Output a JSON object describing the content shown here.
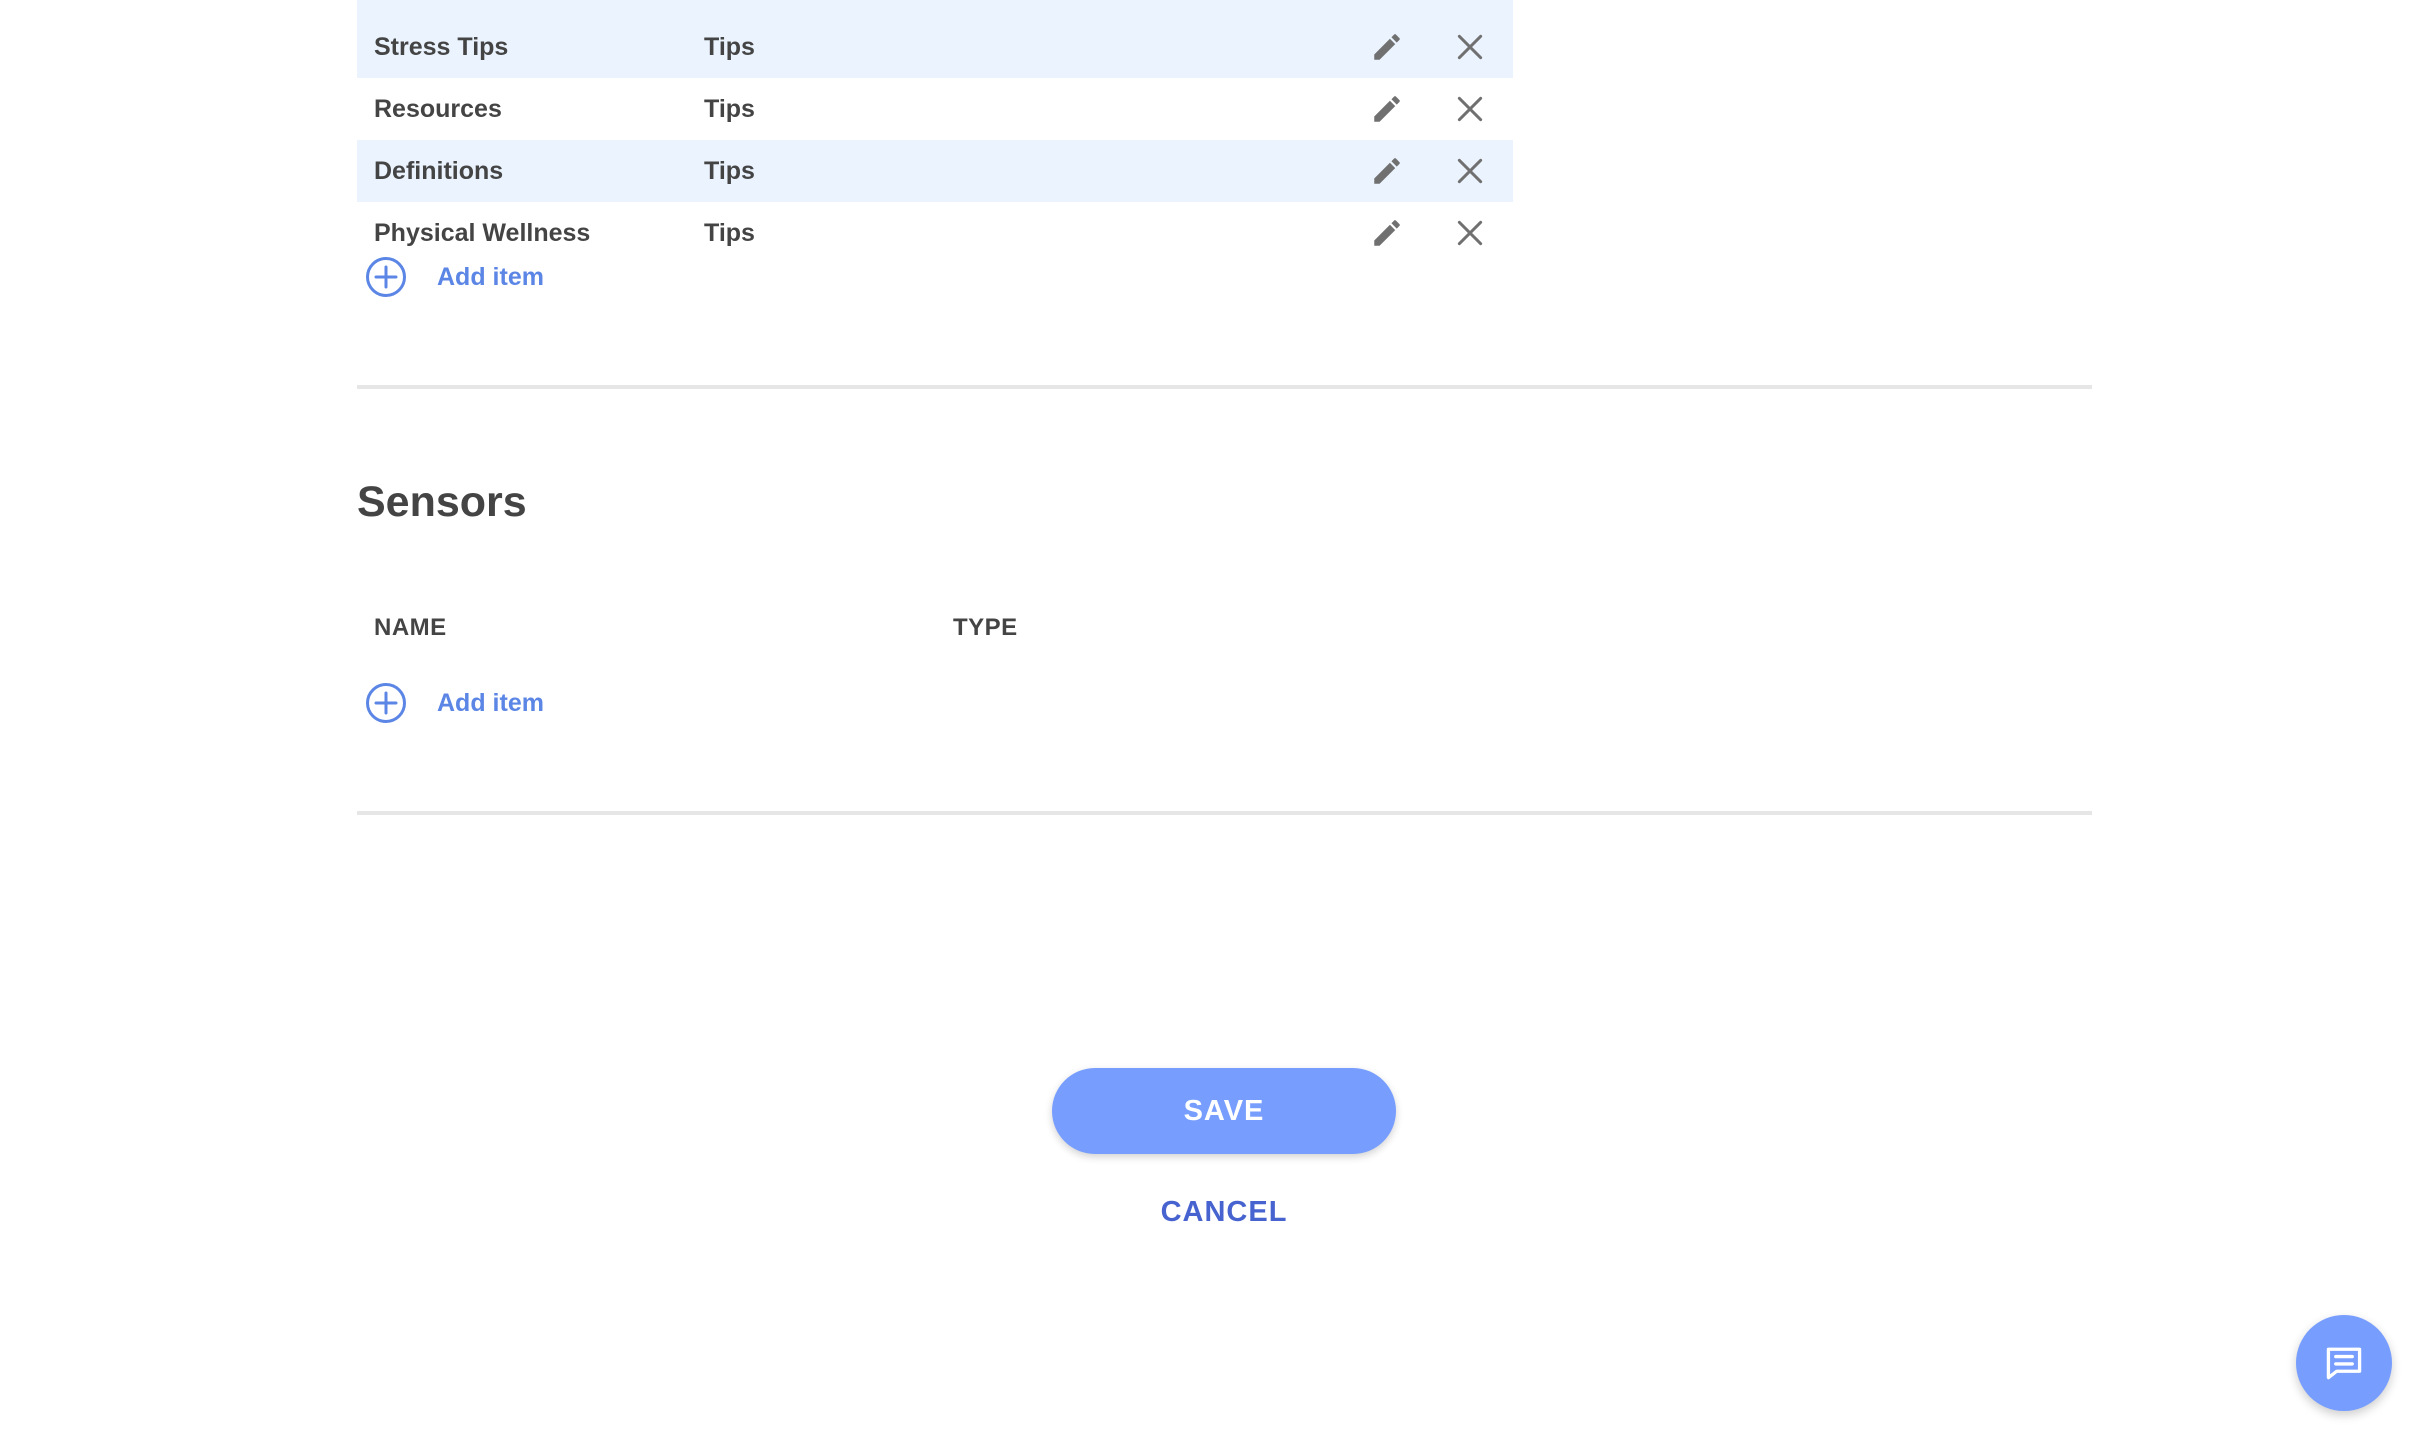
{
  "tips_table": {
    "rows": [
      {
        "name": "Stress Tips",
        "type": "Tips"
      },
      {
        "name": "Resources",
        "type": "Tips"
      },
      {
        "name": "Definitions",
        "type": "Tips"
      },
      {
        "name": "Physical Wellness",
        "type": "Tips"
      }
    ],
    "add_item_label": "Add item"
  },
  "sensors": {
    "title": "Sensors",
    "columns": {
      "name": "NAME",
      "type": "TYPE"
    },
    "add_item_label": "Add item"
  },
  "actions": {
    "save_label": "SAVE",
    "cancel_label": "CANCEL"
  },
  "icons": {
    "edit": "pencil-icon",
    "delete": "close-icon",
    "add": "plus-circle-icon",
    "chat": "chat-icon"
  },
  "colors": {
    "accent": "#779dff",
    "link": "#5b86e5",
    "cancel": "#4763cf",
    "row_shade": "#eaf3fe",
    "text": "#444444"
  }
}
